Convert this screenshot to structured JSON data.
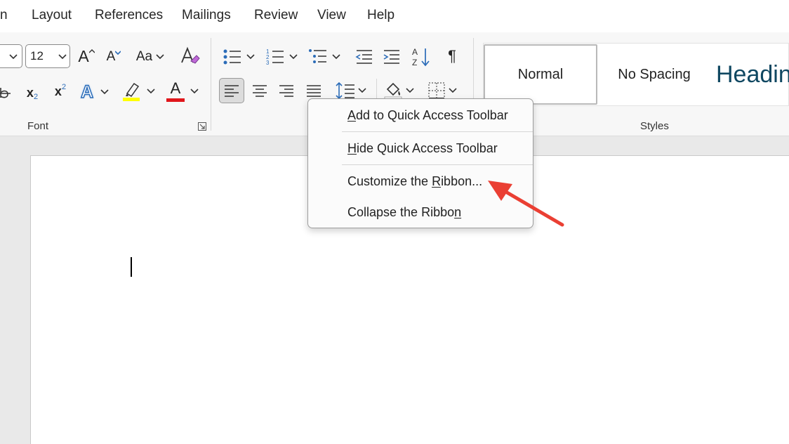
{
  "tabs": [
    {
      "part": "n"
    },
    {
      "label": "Layout"
    },
    {
      "label": "References"
    },
    {
      "label": "Mailings"
    },
    {
      "label": "Review"
    },
    {
      "label": "View"
    },
    {
      "label": "Help"
    }
  ],
  "font": {
    "size_value": "12",
    "grow_label": "A",
    "shrink_label": "A",
    "case_label": "Aa",
    "subscript_label": "x",
    "subscript_index": "2",
    "superscript_label": "x",
    "superscript_index": "2",
    "effects_label": "A",
    "font_color_label": "A",
    "group_label": "Font",
    "highlight_color": "#ffff00",
    "font_color": "#e0161b"
  },
  "paragraph": {
    "pilcrow_label": "¶"
  },
  "styles": {
    "group_label": "Styles",
    "items": [
      {
        "label": "Normal"
      },
      {
        "label": "No Spacing"
      },
      {
        "label": "Headin"
      }
    ],
    "heading_color": "#0f4761"
  },
  "context_menu": {
    "items": [
      {
        "pre": "",
        "key": "A",
        "post": "dd to Quick Access Toolbar"
      },
      {
        "pre": "",
        "key": "H",
        "post": "ide Quick Access Toolbar"
      },
      {
        "pre": "Customize the ",
        "key": "R",
        "post": "ibbon..."
      },
      {
        "pre": "Collapse the Ribbo",
        "key": "n",
        "post": ""
      }
    ]
  },
  "annotation_color": "#ea3f33"
}
